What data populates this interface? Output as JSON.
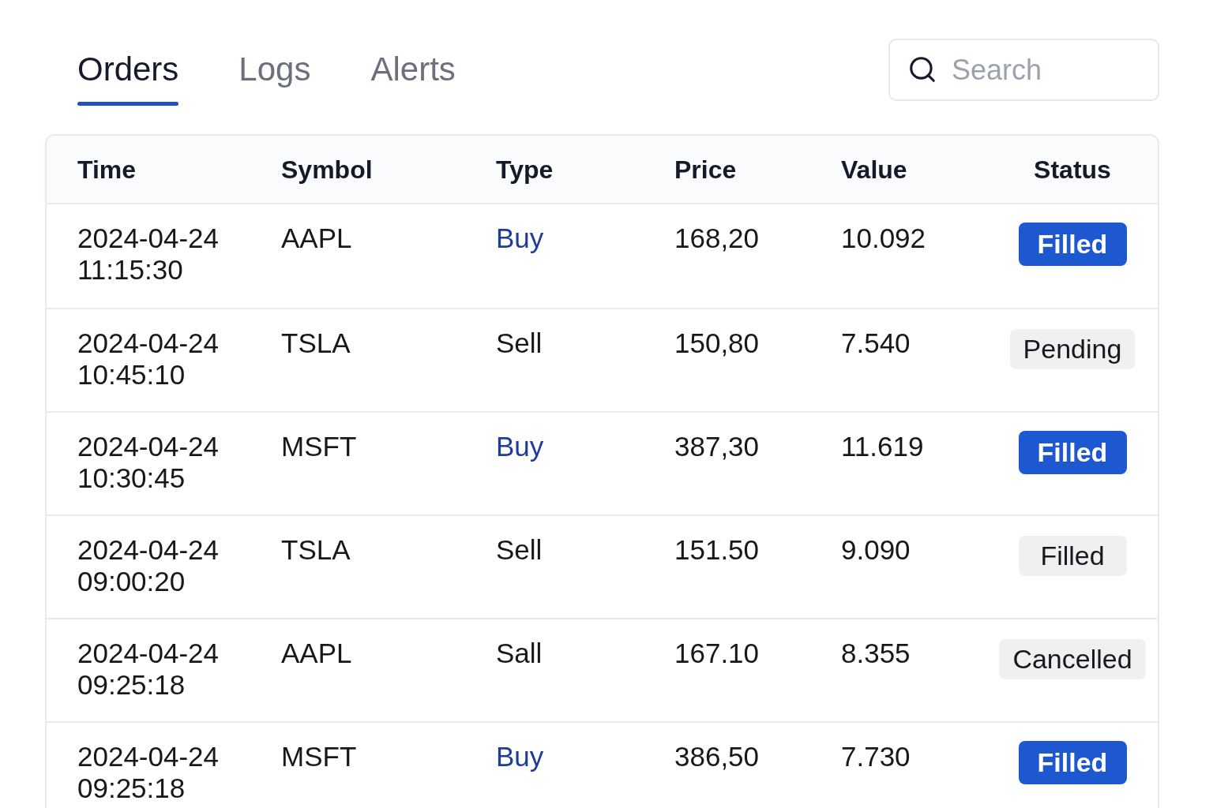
{
  "tabs": [
    {
      "label": "Orders",
      "selected": true
    },
    {
      "label": "Logs",
      "selected": false
    },
    {
      "label": "Alerts",
      "selected": false
    }
  ],
  "search": {
    "placeholder": "Search"
  },
  "table": {
    "columns": [
      "Time",
      "Symbol",
      "Type",
      "Price",
      "Value",
      "Status"
    ],
    "rows": [
      {
        "time": "2024-04-24 11:15:30",
        "symbol": "AAPL",
        "type": {
          "text": "Buy",
          "highlighted": true
        },
        "price": "168,20",
        "value": "10.092",
        "status": {
          "text": "Filled",
          "highlighted": true
        }
      },
      {
        "time": "2024-04-24 10:45:10",
        "symbol": "TSLA",
        "type": {
          "text": "Sell",
          "highlighted": false
        },
        "price": "150,80",
        "value": "7.540",
        "status": {
          "text": "Pending",
          "highlighted": false
        }
      },
      {
        "time": "2024-04-24 10:30:45",
        "symbol": "MSFT",
        "type": {
          "text": "Buy",
          "highlighted": true
        },
        "price": "387,30",
        "value": "11.619",
        "status": {
          "text": "Filled",
          "highlighted": true
        }
      },
      {
        "time": "2024-04-24 09:00:20",
        "symbol": "TSLA",
        "type": {
          "text": "Sell",
          "highlighted": false
        },
        "price": "151.50",
        "value": "9.090",
        "status": {
          "text": "Filled",
          "highlighted": false
        }
      },
      {
        "time": "2024-04-24 09:25:18",
        "symbol": "AAPL",
        "type": {
          "text": "Sall",
          "highlighted": false
        },
        "price": "167.10",
        "value": "8.355",
        "status": {
          "text": "Cancelled",
          "highlighted": false
        }
      },
      {
        "time": "2024-04-24 09:25:18",
        "symbol": "MSFT",
        "type": {
          "text": "Buy",
          "highlighted": true
        },
        "price": "386,50",
        "value": "7.730",
        "status": {
          "text": "Filled",
          "highlighted": true
        }
      }
    ]
  }
}
